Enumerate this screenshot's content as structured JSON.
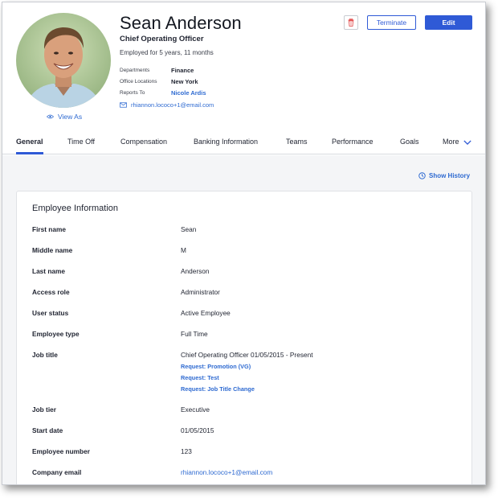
{
  "profile": {
    "name": "Sean Anderson",
    "job_title": "Chief Operating Officer",
    "employed": "Employed for 5 years, 11 months",
    "view_as": "View As",
    "email": "rhiannon.lococo+1@email.com",
    "facts": [
      {
        "key": "Departments",
        "value": "Finance",
        "is_link": false
      },
      {
        "key": "Office Locations",
        "value": "New York",
        "is_link": false
      },
      {
        "key": "Reports To",
        "value": "Nicole Ardis",
        "is_link": true
      }
    ]
  },
  "actions": {
    "terminate": "Terminate",
    "edit": "Edit"
  },
  "tabs": [
    {
      "label": "General",
      "active": true
    },
    {
      "label": "Time Off"
    },
    {
      "label": "Compensation"
    },
    {
      "label": "Banking Information"
    },
    {
      "label": "Teams"
    },
    {
      "label": "Performance"
    },
    {
      "label": "Goals"
    },
    {
      "label": "More"
    }
  ],
  "show_history": "Show History",
  "card": {
    "title": "Employee Information",
    "rows": [
      {
        "label": "First name",
        "value": "Sean"
      },
      {
        "label": "Middle name",
        "value": "M"
      },
      {
        "label": "Last name",
        "value": "Anderson"
      },
      {
        "label": "Access role",
        "value": "Administrator"
      },
      {
        "label": "User status",
        "value": "Active Employee"
      },
      {
        "label": "Employee type",
        "value": "Full Time"
      },
      {
        "label": "Job title",
        "value": "Chief Operating Officer 01/05/2015 - Present",
        "requests": [
          "Request: Promotion (VG)",
          "Request: Test",
          "Request: Job Title Change"
        ]
      },
      {
        "label": "Job tier",
        "value": "Executive"
      },
      {
        "label": "Start date",
        "value": "01/05/2015"
      },
      {
        "label": "Employee number",
        "value": "123"
      },
      {
        "label": "Company email",
        "value": "rhiannon.lococo+1@email.com",
        "is_link": true
      }
    ]
  },
  "colors": {
    "accent": "#2f5ad6",
    "link": "#2e6ad1",
    "danger": "#e03a3a",
    "content_bg": "#f4f5f7"
  },
  "icons": [
    "eye-icon",
    "mail-icon",
    "trash-icon",
    "chevron-down-icon",
    "history-icon"
  ]
}
